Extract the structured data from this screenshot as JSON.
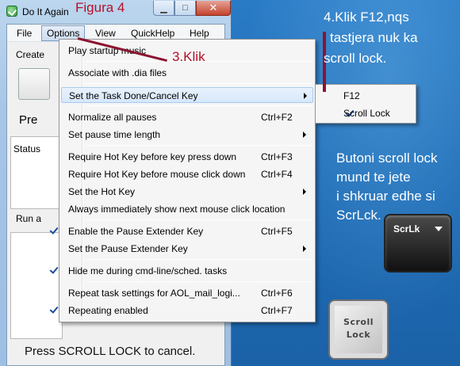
{
  "window": {
    "title": "Do It Again"
  },
  "caption": {
    "minimize": "▁",
    "maximize": "□",
    "close": "✕"
  },
  "menubar": {
    "items": [
      "File",
      "Options",
      "View",
      "QuickHelp",
      "Help"
    ]
  },
  "client": {
    "partial_create": "Create",
    "partial_pre": "Pre",
    "partial_status": "Status",
    "partial_run": "Run a",
    "footer": "Press SCROLL LOCK to cancel."
  },
  "menu": {
    "items": [
      {
        "label": "Play startup music"
      },
      {
        "label": "Associate with .dia files"
      },
      {
        "label": "Set the Task Done/Cancel Key"
      },
      {
        "label": "Normalize all pauses",
        "shortcut": "Ctrl+F2"
      },
      {
        "label": "Set pause time length"
      },
      {
        "label": "Require Hot Key before key press down",
        "shortcut": "Ctrl+F3"
      },
      {
        "label": "Require Hot Key before mouse click down",
        "shortcut": "Ctrl+F4"
      },
      {
        "label": "Set the Hot Key"
      },
      {
        "label": "Always immediately show next mouse click location"
      },
      {
        "label": "Enable the Pause Extender Key",
        "shortcut": "Ctrl+F5"
      },
      {
        "label": "Set the Pause Extender Key"
      },
      {
        "label": "Hide me during cmd-line/sched. tasks"
      },
      {
        "label": "Repeat task settings for AOL_mail_logi...",
        "shortcut": "Ctrl+F6"
      },
      {
        "label": "Repeating enabled",
        "shortcut": "Ctrl+F7"
      }
    ]
  },
  "submenu": {
    "items": [
      "F12",
      "Scroll Lock"
    ]
  },
  "annotations": {
    "figura": "Figura 4",
    "klik": "3.Klik",
    "step4": [
      "4.Klik F12,nqs",
      "tastjera nuk ka",
      "scroll lock."
    ],
    "note": [
      "Butoni scroll lock",
      "mund te jete",
      "i shkruar edhe si",
      "ScrLck."
    ]
  },
  "keys": {
    "dark": "ScrLk",
    "light_line1": "Scroll",
    "light_line2": "Lock"
  },
  "colors": {
    "desktop": "#1f6db7",
    "annotation_red": "#b3112a",
    "highlight": "#d6e7fb"
  }
}
